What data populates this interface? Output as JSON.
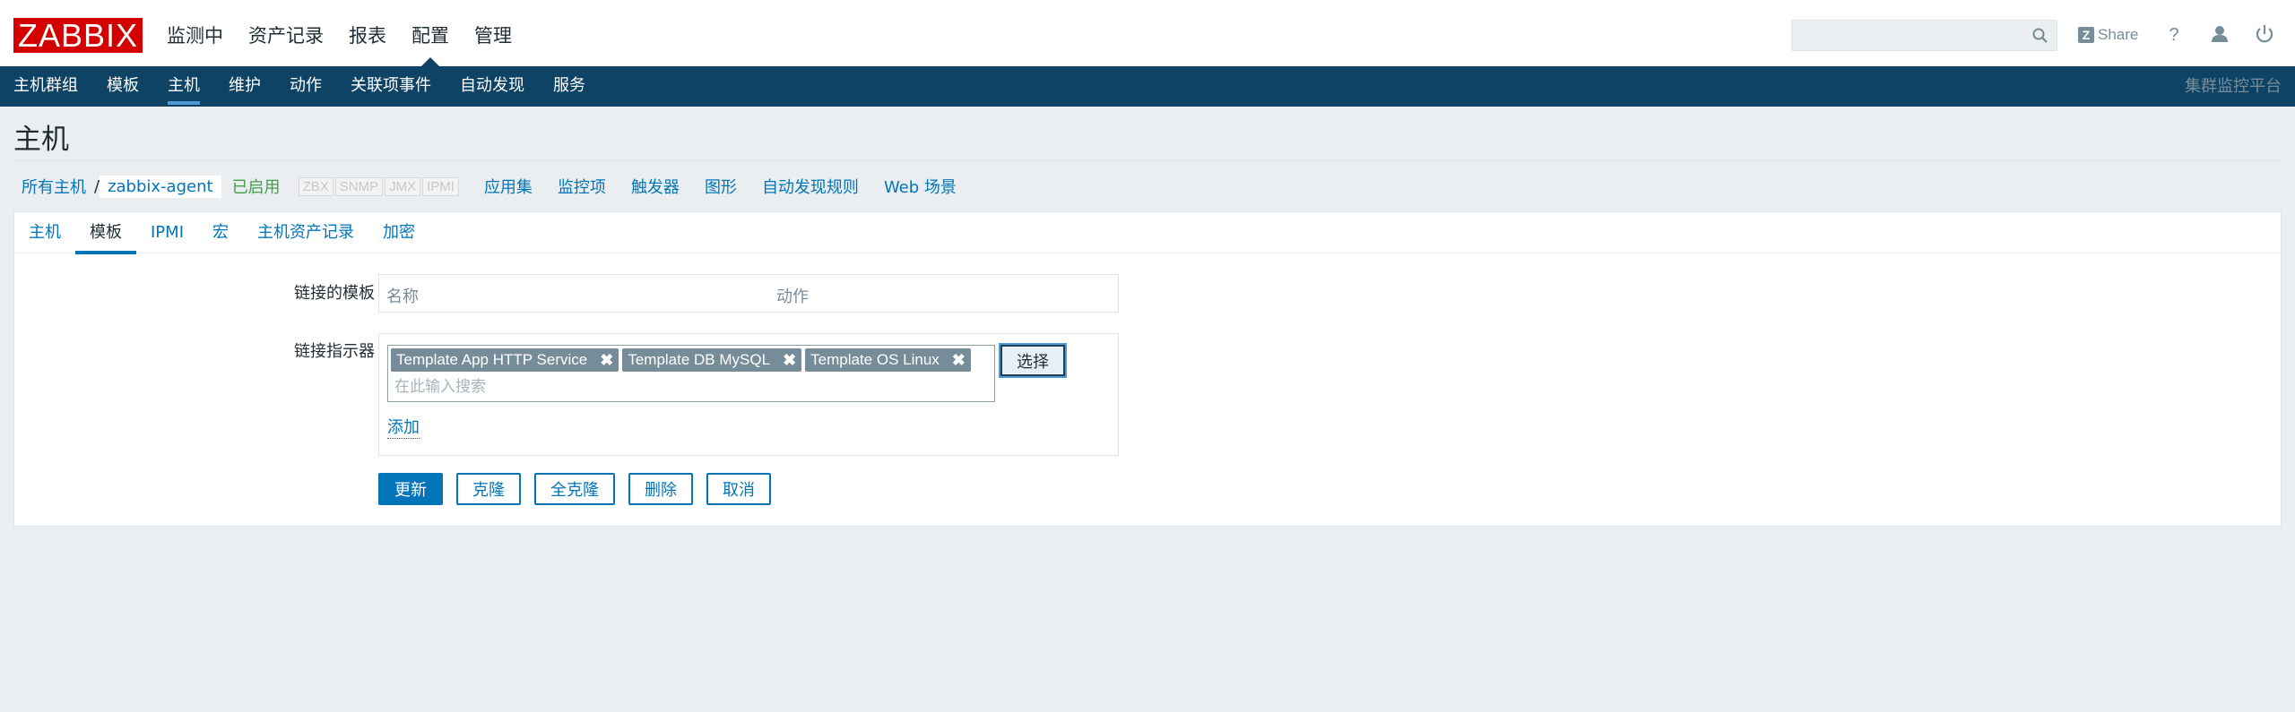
{
  "header": {
    "logo": "ZABBIX",
    "nav": [
      "监测中",
      "资产记录",
      "报表",
      "配置",
      "管理"
    ],
    "active_nav": 3,
    "search": {
      "value": "",
      "placeholder": ""
    },
    "share_label": "Share",
    "icons": [
      "search-icon",
      "help-icon",
      "user-icon",
      "power-icon"
    ]
  },
  "subnav": {
    "items": [
      "主机群组",
      "模板",
      "主机",
      "维护",
      "动作",
      "关联项事件",
      "自动发现",
      "服务"
    ],
    "active": 2,
    "server_name": "集群监控平台"
  },
  "page": {
    "title": "主机"
  },
  "breadcrumb": {
    "all_hosts": "所有主机",
    "separator": "/",
    "host": "zabbix-agent",
    "status": "已启用",
    "availability": [
      "ZBX",
      "SNMP",
      "JMX",
      "IPMI"
    ],
    "links": [
      "应用集",
      "监控项",
      "触发器",
      "图形",
      "自动发现规则",
      "Web 场景"
    ]
  },
  "tabs": {
    "items": [
      "主机",
      "模板",
      "IPMI",
      "宏",
      "主机资产记录",
      "加密"
    ],
    "active": 1
  },
  "form": {
    "linked_templates_label": "链接的模板",
    "col_name": "名称",
    "col_action": "动作",
    "link_indicator_label": "链接指示器",
    "chips": [
      "Template App HTTP Service",
      "Template DB MySQL",
      "Template OS Linux"
    ],
    "search_placeholder": "在此输入搜索",
    "select_button": "选择",
    "add_link": "添加"
  },
  "buttons": {
    "update": "更新",
    "clone": "克隆",
    "full_clone": "全克隆",
    "delete": "删除",
    "cancel": "取消"
  },
  "colors": {
    "brand_red": "#d40000",
    "subnav_bg": "#0e4366",
    "link": "#0275b8",
    "enabled": "#429e47"
  }
}
